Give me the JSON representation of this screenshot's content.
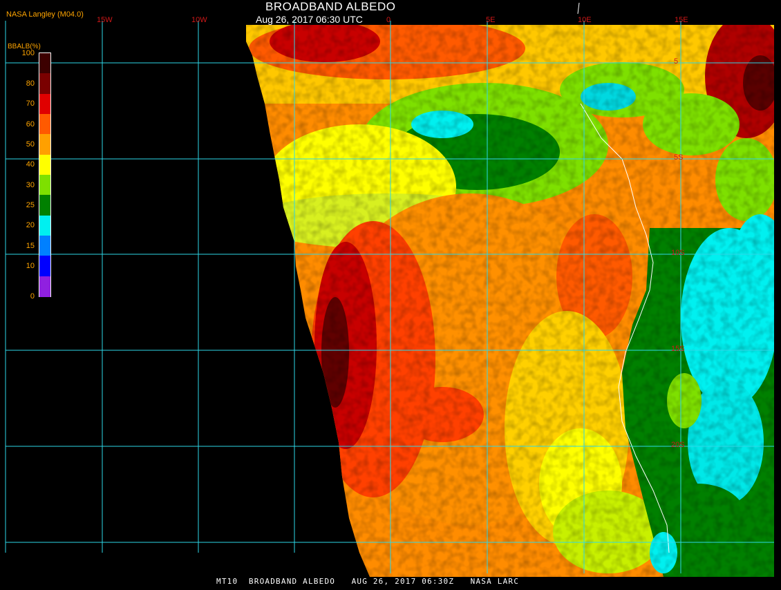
{
  "header": {
    "title": "BROADBAND ALBEDO",
    "subtitle": "Aug 26, 2017 06:30 UTC",
    "organization": "NASA Langley (M04.0)"
  },
  "footer": {
    "text": "MT10  BROADBAND ALBEDO   AUG 26, 2017 06:30Z   NASA LARC"
  },
  "legend": {
    "title": "BBALB(%)",
    "ticks": [
      "100",
      "80",
      "70",
      "60",
      "50",
      "40",
      "30",
      "25",
      "20",
      "15",
      "10",
      "0"
    ],
    "colors": [
      "#3c0000",
      "#7a0000",
      "#e00000",
      "#ff5a00",
      "#ffa000",
      "#ffff00",
      "#7ee000",
      "#008000",
      "#00f0f0",
      "#0080ff",
      "#0000ff",
      "#9020e0"
    ]
  },
  "grid": {
    "lon_labels": [
      "15W",
      "10W",
      "0",
      "5E",
      "10E",
      "15E"
    ],
    "lat_labels": [
      "5",
      "5S",
      "10S",
      "15S",
      "20S"
    ]
  }
}
